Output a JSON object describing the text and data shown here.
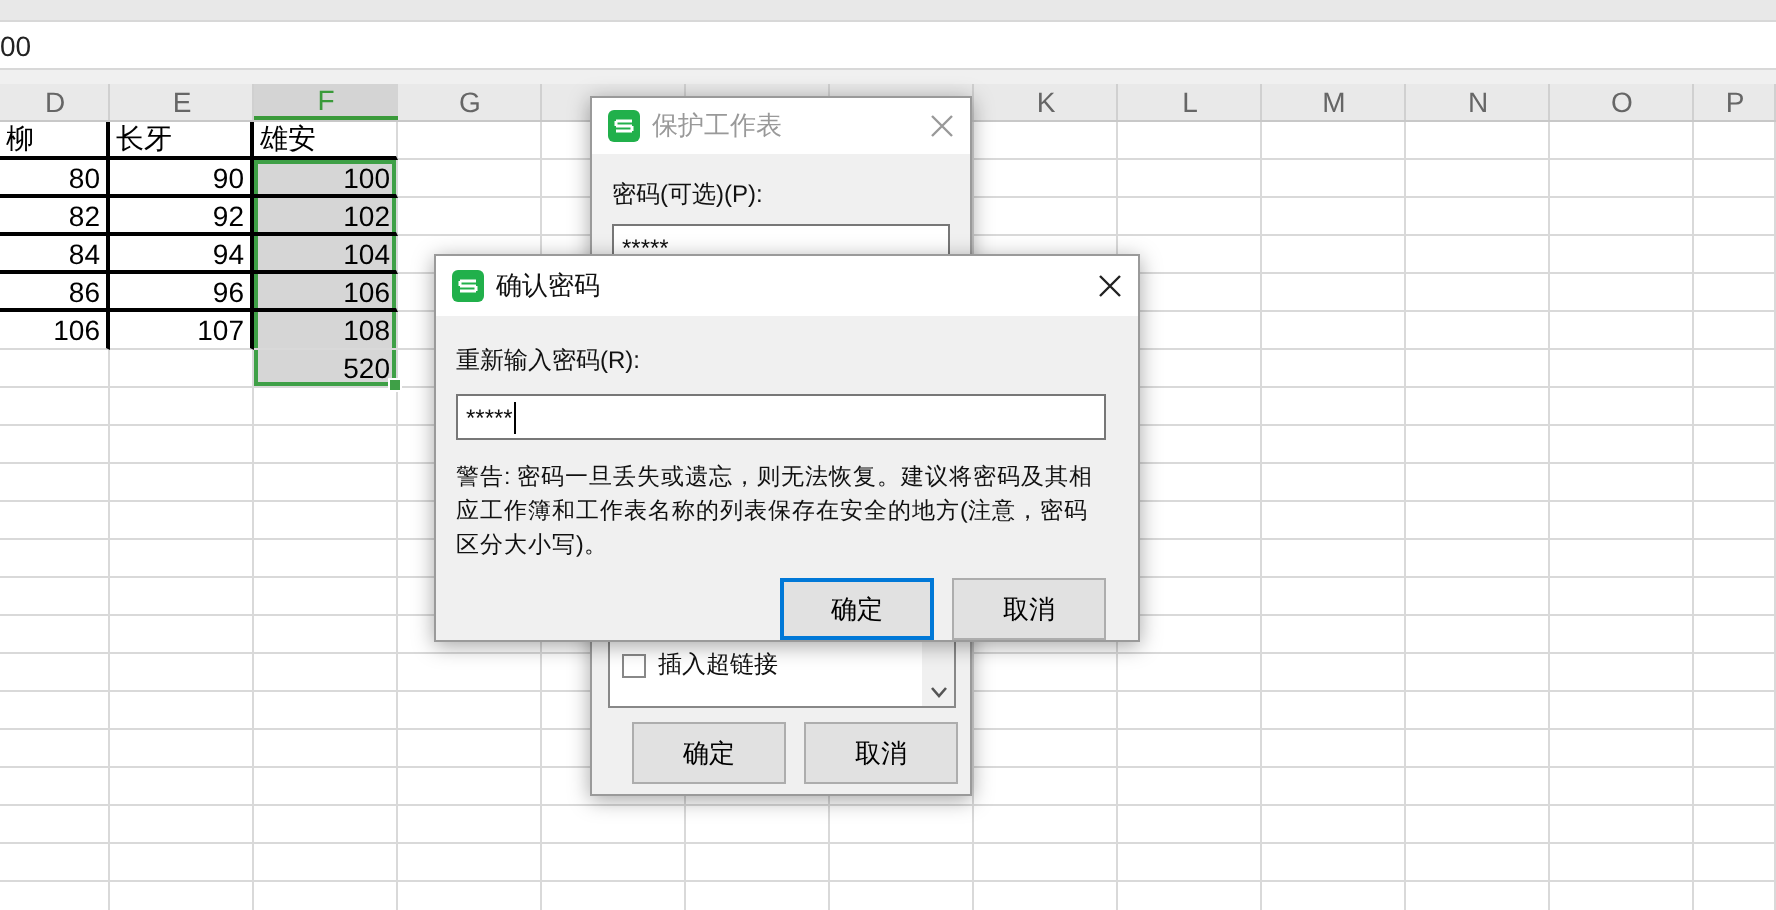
{
  "formula_bar": {
    "value": "00"
  },
  "sheet": {
    "columns": [
      {
        "label": "D",
        "selected": false
      },
      {
        "label": "E",
        "selected": false
      },
      {
        "label": "F",
        "selected": true
      },
      {
        "label": "G",
        "selected": false
      },
      {},
      {},
      {},
      {
        "label": "K",
        "selected": false
      },
      {
        "label": "L",
        "selected": false
      },
      {
        "label": "M",
        "selected": false
      },
      {
        "label": "N",
        "selected": false
      },
      {
        "label": "O",
        "selected": false
      },
      {
        "label": "P",
        "selected": false
      }
    ],
    "rows": [
      {
        "selected": false,
        "cells": [
          "柳",
          "长牙",
          "雄安"
        ]
      },
      {
        "selected": true,
        "cells": [
          "80",
          "90",
          "100"
        ]
      },
      {
        "selected": true,
        "cells": [
          "82",
          "92",
          "102"
        ]
      },
      {
        "selected": true,
        "cells": [
          "84",
          "94",
          "104"
        ]
      },
      {
        "selected": true,
        "cells": [
          "86",
          "96",
          "106"
        ]
      },
      {
        "selected": true,
        "cells": [
          "106",
          "107",
          "108"
        ]
      },
      {
        "selected": true,
        "cells": [
          "",
          "",
          "520"
        ]
      }
    ]
  },
  "protect_dialog": {
    "title": "保护工作表",
    "active": false,
    "password_label": "密码(可选)(P):",
    "password_value": "*****",
    "options": [
      {
        "label": "插入超链接",
        "checked": false
      }
    ],
    "buttons": [
      {
        "label": "确定",
        "default": false
      },
      {
        "label": "取消",
        "default": false
      }
    ]
  },
  "confirm_dialog": {
    "title": "确认密码",
    "active": true,
    "password_label": "重新输入密码(R):",
    "password_value": "*****",
    "warning": "警告: 密码一旦丢失或遗忘，则无法恢复。建议将密码及其相应工作簿和工作表名称的列表保存在安全的地方(注意，密码区分大小写)。",
    "buttons": [
      {
        "label": "确定",
        "default": true
      },
      {
        "label": "取消",
        "default": false
      }
    ]
  }
}
